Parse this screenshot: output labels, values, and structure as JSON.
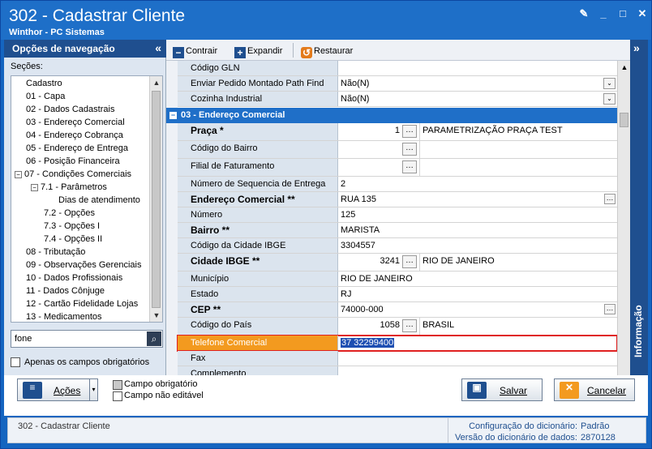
{
  "window": {
    "title": "302 - Cadastrar Cliente",
    "subtitle": "Winthor - PC Sistemas"
  },
  "nav": {
    "header": "Opções de navegação",
    "secoes_label": "Seções:",
    "tree": [
      {
        "label": "Cadastro"
      },
      {
        "label": "01 - Capa"
      },
      {
        "label": "02 - Dados Cadastrais"
      },
      {
        "label": "03 - Endereço Comercial"
      },
      {
        "label": "04 - Endereço Cobrança"
      },
      {
        "label": "05 - Endereço de Entrega"
      },
      {
        "label": "06 - Posição Financeira"
      },
      {
        "label": "07 - Condições Comerciais"
      },
      {
        "label": "7.1 - Parâmetros"
      },
      {
        "label": "Dias de atendimento"
      },
      {
        "label": "7.2 - Opções"
      },
      {
        "label": "7.3 - Opções I"
      },
      {
        "label": "7.4 - Opções II"
      },
      {
        "label": "08 - Tributação"
      },
      {
        "label": "09 - Observações Gerenciais"
      },
      {
        "label": "10 - Dados Profissionais"
      },
      {
        "label": "11 - Dados Cônjuge"
      },
      {
        "label": "12 - Cartão Fidelidade Lojas"
      },
      {
        "label": "13 - Medicamentos"
      }
    ],
    "search_value": "fone",
    "only_required_label": "Apenas os campos obrigatórios"
  },
  "toolbar": {
    "contrair": "Contrair",
    "expandir": "Expandir",
    "restaurar": "Restaurar"
  },
  "grid": {
    "rows_top": [
      {
        "label": "Código GLN",
        "value": ""
      },
      {
        "label": "Enviar Pedido Montado Path Find",
        "value": "Não(N)"
      },
      {
        "label": "Cozinha Industrial",
        "value": "Não(N)"
      }
    ],
    "section_title": "03 - Endereço Comercial",
    "praca": {
      "label": "Praça *",
      "code": "1",
      "desc": "PARAMETRIZAÇÃO PRAÇA TEST"
    },
    "codigo_bairro": {
      "label": "Código do Bairro"
    },
    "filial_faturamento": {
      "label": "Filial de Faturamento"
    },
    "numero_seq": {
      "label": "Número de Sequencia de Entrega",
      "value": "2"
    },
    "endereco": {
      "label": "Endereço Comercial **",
      "value": "RUA 135"
    },
    "numero": {
      "label": "Número",
      "value": "125"
    },
    "bairro": {
      "label": "Bairro **",
      "value": "MARISTA"
    },
    "codigo_cidade_ibge": {
      "label": "Código da Cidade IBGE",
      "value": "3304557"
    },
    "cidade_ibge": {
      "label": "Cidade IBGE **",
      "code": "3241",
      "desc": "RIO DE JANEIRO"
    },
    "municipio": {
      "label": "Município",
      "value": "RIO DE JANEIRO"
    },
    "estado": {
      "label": "Estado",
      "value": "RJ"
    },
    "cep": {
      "label": "CEP **",
      "value": "74000-000"
    },
    "codigo_pais": {
      "label": "Código do País",
      "code": "1058",
      "desc": "BRASIL"
    },
    "telefone": {
      "label": "Telefone Comercial",
      "value": "37 32299400"
    },
    "fax": {
      "label": "Fax"
    },
    "complemento": {
      "label": "Complemento"
    }
  },
  "info_panel": "Informação",
  "bottom": {
    "acoes": "Ações",
    "campo_obrigatorio": "Campo obrigatório",
    "campo_nao_editavel": "Campo não editável",
    "salvar": "Salvar",
    "cancelar": "Cancelar"
  },
  "status": {
    "left": "302 - Cadastrar Cliente",
    "config_label": "Configuração do dicionário:",
    "config_value": "Padrão",
    "versao_label": "Versão do dicionário de dados:",
    "versao_value": "2870128"
  },
  "colors": {
    "accent": "#1e6fc8",
    "selected_label": "#f39a1f",
    "selection_outline": "#e02020"
  }
}
